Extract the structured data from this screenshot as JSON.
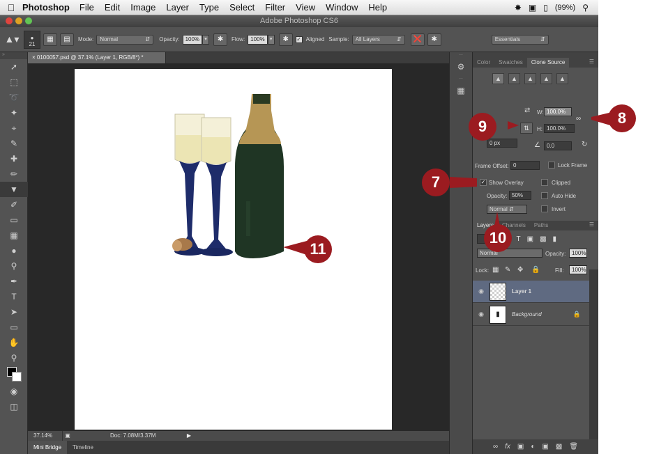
{
  "menubar": {
    "app": "Photoshop",
    "items": [
      "File",
      "Edit",
      "Image",
      "Layer",
      "Type",
      "Select",
      "Filter",
      "View",
      "Window",
      "Help"
    ],
    "battery": "(99%)"
  },
  "window": {
    "title": "Adobe Photoshop CS6"
  },
  "options": {
    "brush_size": "21",
    "mode_label": "Mode:",
    "mode_value": "Normal",
    "opacity_label": "Opacity:",
    "opacity_value": "100%",
    "flow_label": "Flow:",
    "flow_value": "100%",
    "aligned_label": "Aligned",
    "sample_label": "Sample:",
    "sample_value": "All Layers",
    "workspace": "Essentials"
  },
  "document": {
    "tab_title": "0100057.psd @ 37.1% (Layer 1, RGB/8*) *",
    "zoom": "37.14%",
    "doc_size": "Doc: 7.08M/3.37M"
  },
  "bottom_tabs": [
    "Mini Bridge",
    "Timeline"
  ],
  "clone_source_panel": {
    "tabs": [
      "Color",
      "Swatches",
      "Clone Source"
    ],
    "w_label": "W:",
    "w_value": "100.0%",
    "h_label": "H:",
    "h_value": "100.0%",
    "x_offset": "0 px",
    "angle_value": "0.0",
    "frame_offset_label": "Frame Offset:",
    "frame_offset_value": "0",
    "lock_frame_label": "Lock Frame",
    "show_overlay_label": "Show Overlay",
    "clipped_label": "Clipped",
    "opacity_label": "Opacity:",
    "opacity_value": "50%",
    "auto_hide_label": "Auto Hide",
    "blend_value": "Normal",
    "invert_label": "Invert"
  },
  "layers_panel": {
    "tabs": [
      "Layers",
      "Channels",
      "Paths"
    ],
    "blend_mode": "Normal",
    "opacity_label": "Opacity:",
    "opacity_value": "100%",
    "lock_label": "Lock:",
    "fill_label": "Fill:",
    "fill_value": "100%",
    "layers": [
      {
        "name": "Layer 1"
      },
      {
        "name": "Background"
      }
    ]
  },
  "callouts": [
    "7",
    "8",
    "9",
    "10",
    "11"
  ],
  "colors": {
    "callout": "#9b1b20",
    "panel": "#535353",
    "workspace": "#282828"
  }
}
